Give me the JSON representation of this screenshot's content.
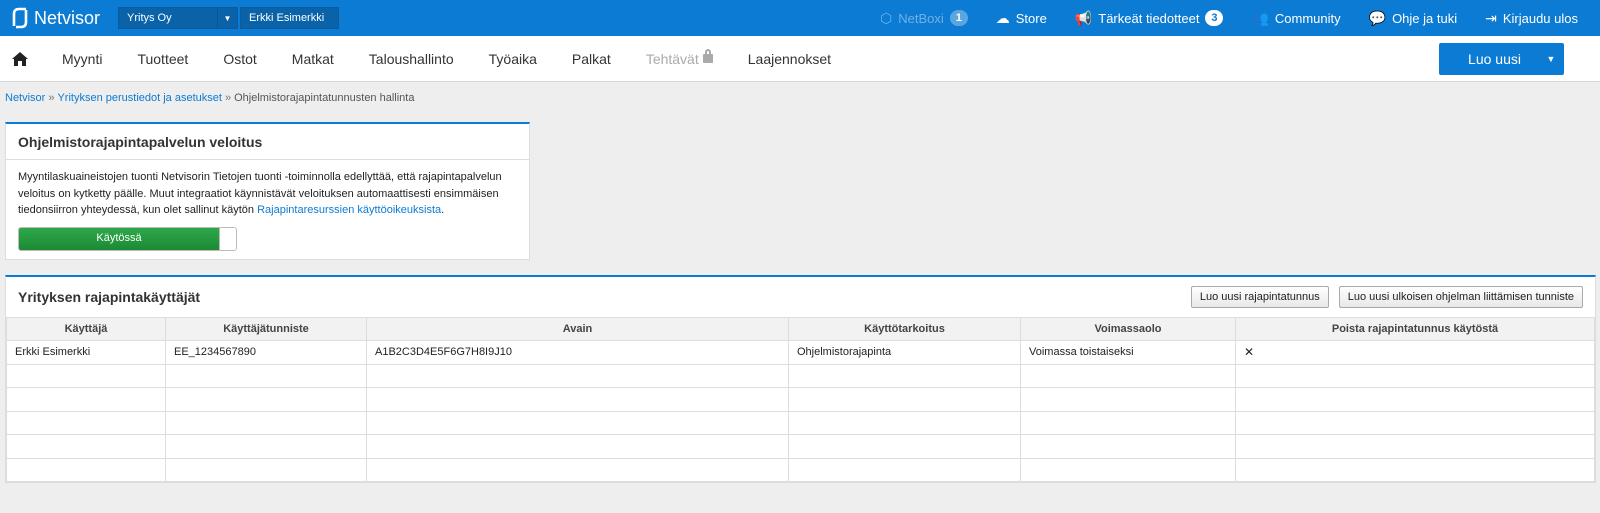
{
  "topbar": {
    "logo_text": "Netvisor",
    "company": "Yritys Oy",
    "user": "Erkki Esimerkki",
    "items": [
      {
        "label": "NetBoxi",
        "badge": "1",
        "icon": "box-icon"
      },
      {
        "label": "Store",
        "icon": "cloud-icon"
      },
      {
        "label": "Tärkeät tiedotteet",
        "badge": "3",
        "icon": "megaphone-icon"
      },
      {
        "label": "Community",
        "icon": "users-icon"
      },
      {
        "label": "Ohje ja tuki",
        "icon": "help-icon"
      },
      {
        "label": "Kirjaudu ulos",
        "icon": "logout-icon"
      }
    ]
  },
  "nav": {
    "items": [
      "Myynti",
      "Tuotteet",
      "Ostot",
      "Matkat",
      "Taloushallinto",
      "Työaika",
      "Palkat",
      "Tehtävät",
      "Laajennokset"
    ],
    "create_label": "Luo uusi"
  },
  "breadcrumb": {
    "part1": "Netvisor",
    "part2": "Yrityksen perustiedot ja asetukset",
    "current": "Ohjelmistorajapintatunnusten hallinta",
    "sep": "»"
  },
  "billing": {
    "title": "Ohjelmistorajapintapalvelun veloitus",
    "text_line1": "Myyntilaskuaineistojen tuonti Netvisorin Tietojen tuonti -toiminnolla edellyttää, että rajapintapalvelun",
    "text_line2": "veloitus on kytketty päälle. Muut integraatiot käynnistävät veloituksen automaattisesti ensimmäisen",
    "text_line3": "tiedonsiirron yhteydessä, kun olet sallinut käytön",
    "link": "Rajapintaresurssien käyttöoikeuksista",
    "toggle_label": "Käytössä"
  },
  "users": {
    "title": "Yrityksen rajapintakäyttäjät",
    "btn_new": "Luo uusi rajapintatunnus",
    "btn_external": "Luo uusi ulkoisen ohjelman liittämisen tunniste",
    "columns": [
      "Käyttäjä",
      "Käyttäjätunniste",
      "Avain",
      "Käyttötarkoitus",
      "Voimassaolo",
      "Poista rajapintatunnus käytöstä"
    ],
    "rows": [
      [
        "Erkki Esimerkki",
        "EE_1234567890",
        "A1B2C3D4E5F6G7H8I9J10",
        "Ohjelmistorajapinta",
        "Voimassa toistaiseksi",
        "✕"
      ]
    ]
  }
}
